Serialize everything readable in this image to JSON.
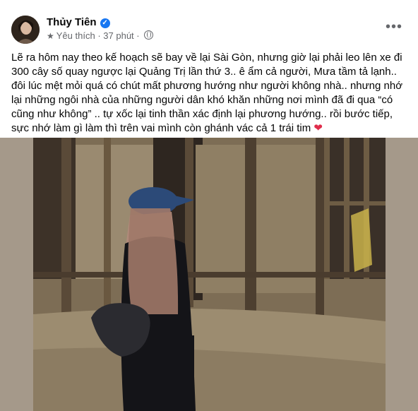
{
  "post": {
    "author": "Thủy Tiên",
    "audience": "Yêu thích",
    "separator": "·",
    "time": "37 phút",
    "more_label": "•••",
    "text": "Lẽ ra hôm nay theo kế hoạch sẽ bay về lại Sài Gòn, nhưng giờ lại phải leo lên xe đi 300 cây số quay ngược lại Quảng Trị lần thứ 3.. ê ẩm cả người, Mưa tầm tả lạnh.. đôi lúc mệt mỏi quá có chút mất phương hướng như người không nhà.. nhưng nhớ lại những ngôi nhà của những người dân khó khăn những nơi mình đã đi qua “có cũng như không” .. tự xốc lại tinh thần xác định lại phương hướng.. rồi bước tiếp, sực nhớ làm gì làm thì trên  vai mình còn ghánh vác cả 1 trái tim",
    "emoji": "❤"
  },
  "icons": {
    "verified": "verified-badge-icon",
    "star": "star-icon",
    "globe": "globe-icon",
    "more": "more-options-icon"
  },
  "colors": {
    "name": "#050505",
    "meta": "#65676b",
    "verified": "#1877f2",
    "heart": "#e02d4b",
    "photo_border": "#a5998a"
  }
}
